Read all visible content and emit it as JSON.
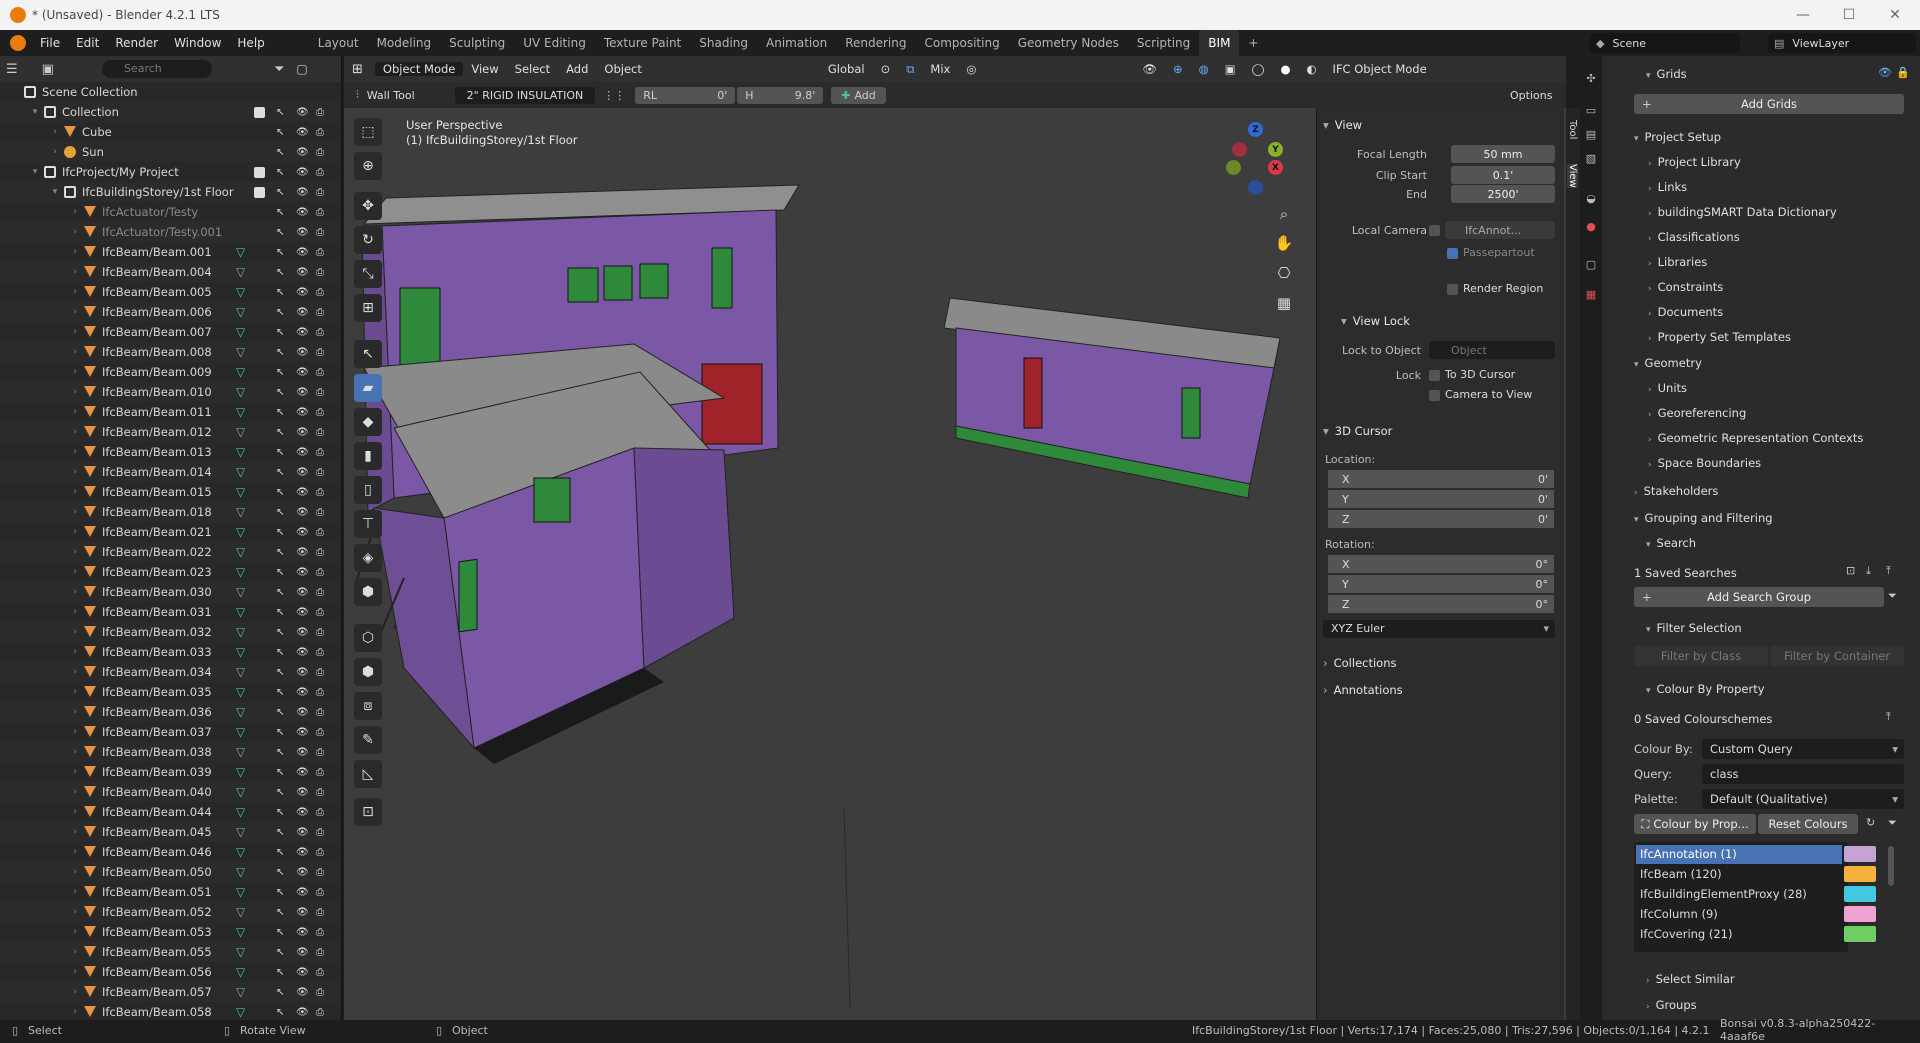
{
  "window": {
    "title": "* (Unsaved) - Blender 4.2.1 LTS",
    "minimize": "—",
    "maximize": "☐",
    "close": "✕"
  },
  "menus": [
    "File",
    "Edit",
    "Render",
    "Window",
    "Help"
  ],
  "workspaces": [
    "Layout",
    "Modeling",
    "Sculpting",
    "UV Editing",
    "Texture Paint",
    "Shading",
    "Animation",
    "Rendering",
    "Compositing",
    "Geometry Nodes",
    "Scripting",
    "BIM"
  ],
  "active_workspace": "BIM",
  "scene": "Scene",
  "viewlayer": "ViewLayer",
  "outliner": {
    "search_placeholder": "Search",
    "rows": [
      {
        "label": "Scene Collection",
        "indent": 0,
        "icon": "collection",
        "exp": "",
        "dim": false
      },
      {
        "label": "Collection",
        "indent": 1,
        "icon": "collection",
        "exp": "▾",
        "dim": false,
        "check": true
      },
      {
        "label": "Cube",
        "indent": 2,
        "icon": "tri",
        "exp": "›",
        "dim": false
      },
      {
        "label": "Sun",
        "indent": 2,
        "icon": "sun",
        "exp": "›",
        "dim": false
      },
      {
        "label": "IfcProject/My Project",
        "indent": 1,
        "icon": "collection",
        "exp": "▾",
        "dim": false,
        "check": true
      },
      {
        "label": "IfcBuildingStorey/1st Floor",
        "indent": 2,
        "icon": "collection",
        "exp": "▾",
        "dim": false,
        "check": true
      },
      {
        "label": "IfcActuator/Testy",
        "indent": 3,
        "icon": "tri",
        "exp": "›",
        "dim": true
      },
      {
        "label": "IfcActuator/Testy.001",
        "indent": 3,
        "icon": "tri",
        "exp": "›",
        "dim": true
      },
      {
        "label": "IfcBeam/Beam.001",
        "indent": 3,
        "icon": "tri",
        "exp": "›"
      },
      {
        "label": "IfcBeam/Beam.004",
        "indent": 3,
        "icon": "tri",
        "exp": "›"
      },
      {
        "label": "IfcBeam/Beam.005",
        "indent": 3,
        "icon": "tri",
        "exp": "›"
      },
      {
        "label": "IfcBeam/Beam.006",
        "indent": 3,
        "icon": "tri",
        "exp": "›"
      },
      {
        "label": "IfcBeam/Beam.007",
        "indent": 3,
        "icon": "tri",
        "exp": "›"
      },
      {
        "label": "IfcBeam/Beam.008",
        "indent": 3,
        "icon": "tri",
        "exp": "›"
      },
      {
        "label": "IfcBeam/Beam.009",
        "indent": 3,
        "icon": "tri",
        "exp": "›"
      },
      {
        "label": "IfcBeam/Beam.010",
        "indent": 3,
        "icon": "tri",
        "exp": "›"
      },
      {
        "label": "IfcBeam/Beam.011",
        "indent": 3,
        "icon": "tri",
        "exp": "›"
      },
      {
        "label": "IfcBeam/Beam.012",
        "indent": 3,
        "icon": "tri",
        "exp": "›"
      },
      {
        "label": "IfcBeam/Beam.013",
        "indent": 3,
        "icon": "tri",
        "exp": "›"
      },
      {
        "label": "IfcBeam/Beam.014",
        "indent": 3,
        "icon": "tri",
        "exp": "›"
      },
      {
        "label": "IfcBeam/Beam.015",
        "indent": 3,
        "icon": "tri",
        "exp": "›"
      },
      {
        "label": "IfcBeam/Beam.018",
        "indent": 3,
        "icon": "tri",
        "exp": "›"
      },
      {
        "label": "IfcBeam/Beam.021",
        "indent": 3,
        "icon": "tri",
        "exp": "›"
      },
      {
        "label": "IfcBeam/Beam.022",
        "indent": 3,
        "icon": "tri",
        "exp": "›"
      },
      {
        "label": "IfcBeam/Beam.023",
        "indent": 3,
        "icon": "tri",
        "exp": "›"
      },
      {
        "label": "IfcBeam/Beam.030",
        "indent": 3,
        "icon": "tri",
        "exp": "›"
      },
      {
        "label": "IfcBeam/Beam.031",
        "indent": 3,
        "icon": "tri",
        "exp": "›"
      },
      {
        "label": "IfcBeam/Beam.032",
        "indent": 3,
        "icon": "tri",
        "exp": "›"
      },
      {
        "label": "IfcBeam/Beam.033",
        "indent": 3,
        "icon": "tri",
        "exp": "›"
      },
      {
        "label": "IfcBeam/Beam.034",
        "indent": 3,
        "icon": "tri",
        "exp": "›"
      },
      {
        "label": "IfcBeam/Beam.035",
        "indent": 3,
        "icon": "tri",
        "exp": "›"
      },
      {
        "label": "IfcBeam/Beam.036",
        "indent": 3,
        "icon": "tri",
        "exp": "›"
      },
      {
        "label": "IfcBeam/Beam.037",
        "indent": 3,
        "icon": "tri",
        "exp": "›"
      },
      {
        "label": "IfcBeam/Beam.038",
        "indent": 3,
        "icon": "tri",
        "exp": "›"
      },
      {
        "label": "IfcBeam/Beam.039",
        "indent": 3,
        "icon": "tri",
        "exp": "›"
      },
      {
        "label": "IfcBeam/Beam.040",
        "indent": 3,
        "icon": "tri",
        "exp": "›"
      },
      {
        "label": "IfcBeam/Beam.044",
        "indent": 3,
        "icon": "tri",
        "exp": "›"
      },
      {
        "label": "IfcBeam/Beam.045",
        "indent": 3,
        "icon": "tri",
        "exp": "›"
      },
      {
        "label": "IfcBeam/Beam.046",
        "indent": 3,
        "icon": "tri",
        "exp": "›"
      },
      {
        "label": "IfcBeam/Beam.050",
        "indent": 3,
        "icon": "tri",
        "exp": "›"
      },
      {
        "label": "IfcBeam/Beam.051",
        "indent": 3,
        "icon": "tri",
        "exp": "›"
      },
      {
        "label": "IfcBeam/Beam.052",
        "indent": 3,
        "icon": "tri",
        "exp": "›"
      },
      {
        "label": "IfcBeam/Beam.053",
        "indent": 3,
        "icon": "tri",
        "exp": "›"
      },
      {
        "label": "IfcBeam/Beam.055",
        "indent": 3,
        "icon": "tri",
        "exp": "›"
      },
      {
        "label": "IfcBeam/Beam.056",
        "indent": 3,
        "icon": "tri",
        "exp": "›"
      },
      {
        "label": "IfcBeam/Beam.057",
        "indent": 3,
        "icon": "tri",
        "exp": "›"
      },
      {
        "label": "IfcBeam/Beam.058",
        "indent": 3,
        "icon": "tri",
        "exp": "›"
      }
    ]
  },
  "viewport_header": {
    "mode": "Object Mode",
    "view": "View",
    "select": "Select",
    "add": "Add",
    "object": "Object",
    "orientation": "Global",
    "snap_mix": "Mix",
    "ifc_mode": "IFC Object Mode"
  },
  "tool_header": {
    "tool": "Wall Tool",
    "material": "2\" RIGID INSULATION",
    "rl_label": "RL",
    "rl_value": "0'",
    "h_label": "H",
    "h_value": "9.8'",
    "add": "Add",
    "options": "Options"
  },
  "viewport": {
    "perspective": "User Perspective",
    "context": "(1) IfcBuildingStorey/1st Floor"
  },
  "npanel": {
    "view_title": "View",
    "focal_length_label": "Focal Length",
    "focal_length": "50 mm",
    "clip_start_label": "Clip Start",
    "clip_start": "0.1'",
    "end_label": "End",
    "end": "2500'",
    "local_camera_label": "Local Camera",
    "local_camera": "IfcAnnot...",
    "passepartout": "Passepartout",
    "render_region": "Render Region",
    "view_lock_title": "View Lock",
    "lock_to_object_label": "Lock to Object",
    "lock_to_object_placeholder": "Object",
    "lock_label": "Lock",
    "to_3d_cursor": "To 3D Cursor",
    "camera_to_view": "Camera to View",
    "cursor_title": "3D Cursor",
    "location_label": "Location:",
    "loc": [
      {
        "axis": "X",
        "v": "0'"
      },
      {
        "axis": "Y",
        "v": "0'"
      },
      {
        "axis": "Z",
        "v": "0'"
      }
    ],
    "rotation_label": "Rotation:",
    "rot": [
      {
        "axis": "X",
        "v": "0°"
      },
      {
        "axis": "Y",
        "v": "0°"
      },
      {
        "axis": "Z",
        "v": "0°"
      }
    ],
    "rotation_mode": "XYZ Euler",
    "collections": "Collections",
    "annotations": "Annotations",
    "tab_tool": "Tool",
    "tab_view": "View"
  },
  "props": {
    "grids": "Grids",
    "add_grids": "Add Grids",
    "project_setup": "Project Setup",
    "setup_items": [
      "Project Library",
      "Links",
      "buildingSMART Data Dictionary",
      "Classifications",
      "Libraries",
      "Constraints",
      "Documents",
      "Property Set Templates"
    ],
    "geometry": "Geometry",
    "geometry_items": [
      "Units",
      "Georeferencing",
      "Geometric Representation Contexts",
      "Space Boundaries"
    ],
    "stakeholders": "Stakeholders",
    "grouping": "Grouping and Filtering",
    "search": "Search",
    "saved_searches": "1 Saved Searches",
    "add_search_group": "Add Search Group",
    "filter_selection": "Filter Selection",
    "filter_by_class": "Filter by Class",
    "filter_by_container": "Filter by Container",
    "colour_by_property": "Colour By Property",
    "saved_colourschemes": "0 Saved Colourschemes",
    "colour_by_label": "Colour By:",
    "colour_by": "Custom Query",
    "query_label": "Query:",
    "query": "class",
    "palette_label": "Palette:",
    "palette": "Default (Qualitative)",
    "colour_by_prop_btn": "Colour by Prop...",
    "reset_colours": "Reset Colours",
    "classes": [
      {
        "name": "IfcAnnotation (1)",
        "color": "#c7a2d6"
      },
      {
        "name": "IfcBeam (120)",
        "color": "#f2b23c"
      },
      {
        "name": "IfcBuildingElementProxy (28)",
        "color": "#43c8e0"
      },
      {
        "name": "IfcColumn (9)",
        "color": "#f0a3d2"
      },
      {
        "name": "IfcCovering (21)",
        "color": "#6fcf62"
      }
    ],
    "select_similar": "Select Similar",
    "groups": "Groups"
  },
  "status": {
    "select": "Select",
    "rotate_view": "Rotate View",
    "object": "Object",
    "stats": "IfcBuildingStorey/1st Floor | Verts:17,174 | Faces:25,080 | Tris:27,596 | Objects:0/1,164 | 4.2.1",
    "version": "Bonsai v0.8.3-alpha250422-4aaaf6e"
  }
}
